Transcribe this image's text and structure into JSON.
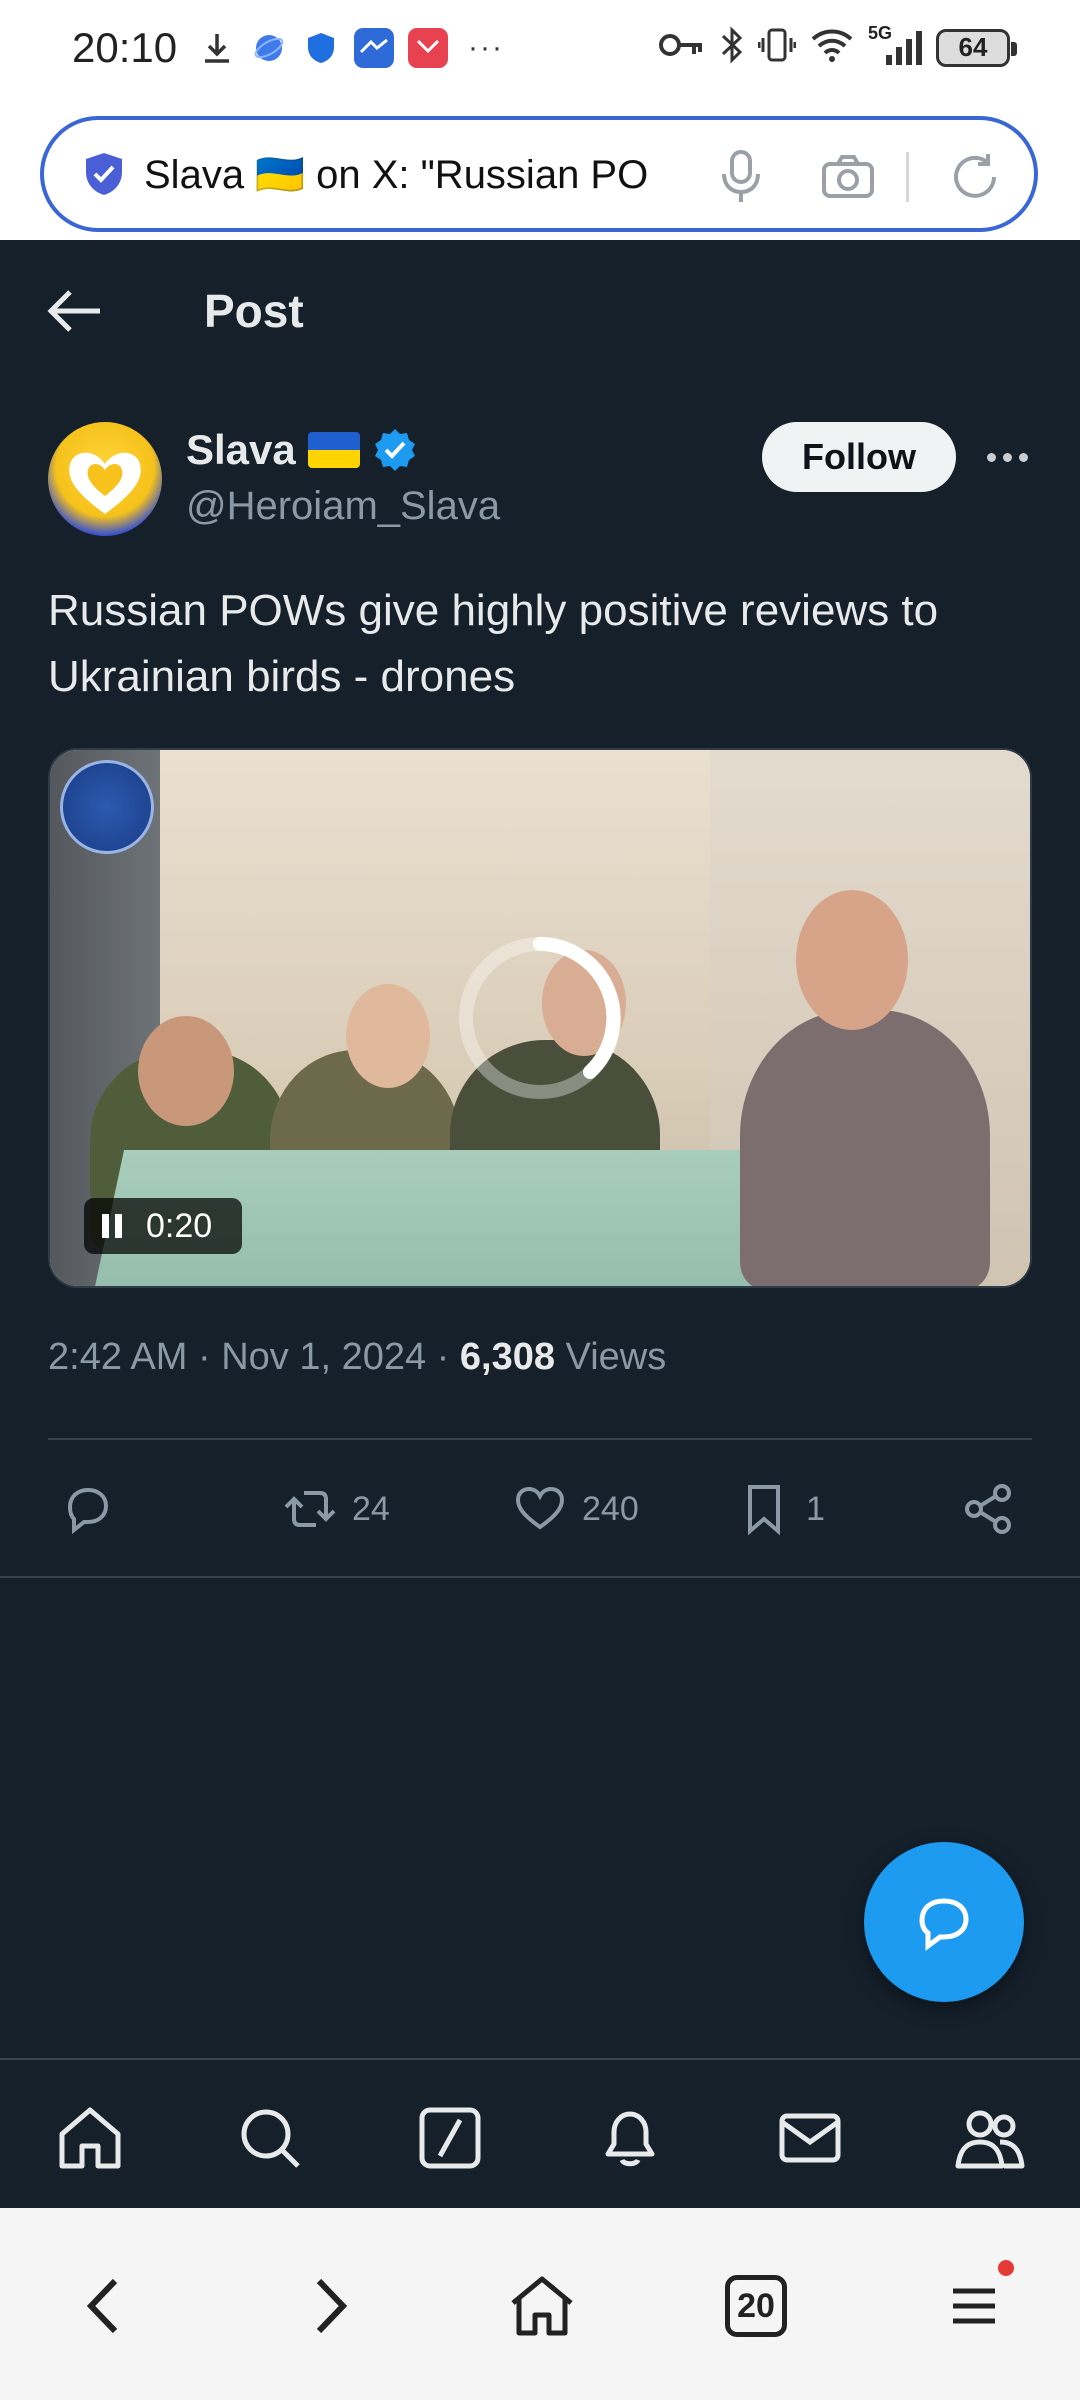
{
  "status_bar": {
    "time": "20:10",
    "more": "···",
    "network": "5G",
    "battery": "64"
  },
  "browser": {
    "url_text": "Slava 🇺🇦 on X: \"Russian PO",
    "tab_count": "20"
  },
  "header": {
    "title": "Post"
  },
  "author": {
    "name": "Slava",
    "handle": "@Heroiam_Slava",
    "follow_label": "Follow"
  },
  "tweet": {
    "text": "Russian POWs give highly positive reviews to Ukrainian birds - drones",
    "video_time": "0:20",
    "timestamp": "2:42 AM · Nov 1, 2024 · ",
    "views_count": "6,308",
    "views_label": " Views"
  },
  "actions": {
    "reposts": "24",
    "likes": "240",
    "bookmarks": "1"
  },
  "colors": {
    "background": "#15202b",
    "accent": "#1d9bf0",
    "text_secondary": "#8b98a5"
  },
  "icons": [
    "back-arrow-icon",
    "verified-icon",
    "more-icon",
    "reply-icon",
    "repost-icon",
    "like-icon",
    "bookmark-icon",
    "share-icon",
    "compose-reply-icon",
    "home-icon",
    "search-icon",
    "grok-icon",
    "notifications-icon",
    "messages-icon",
    "communities-icon"
  ]
}
